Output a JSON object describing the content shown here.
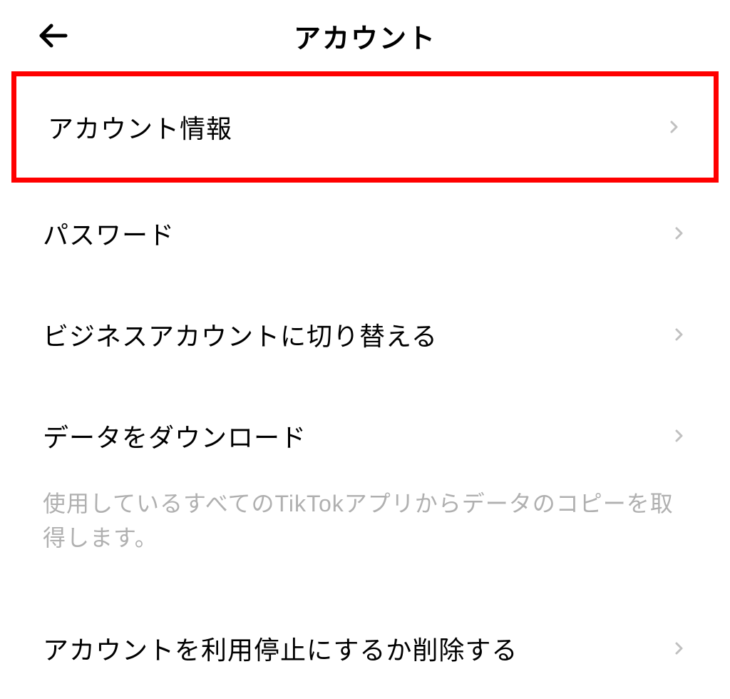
{
  "header": {
    "title": "アカウント"
  },
  "items": [
    {
      "label": "アカウント情報",
      "highlighted": true
    },
    {
      "label": "パスワード",
      "highlighted": false
    },
    {
      "label": "ビジネスアカウントに切り替える",
      "highlighted": false
    },
    {
      "label": "データをダウンロード",
      "highlighted": false,
      "description": "使用しているすべてのTikTokアプリからデータのコピーを取得します。"
    },
    {
      "label": "アカウントを利用停止にするか削除する",
      "highlighted": false
    }
  ]
}
